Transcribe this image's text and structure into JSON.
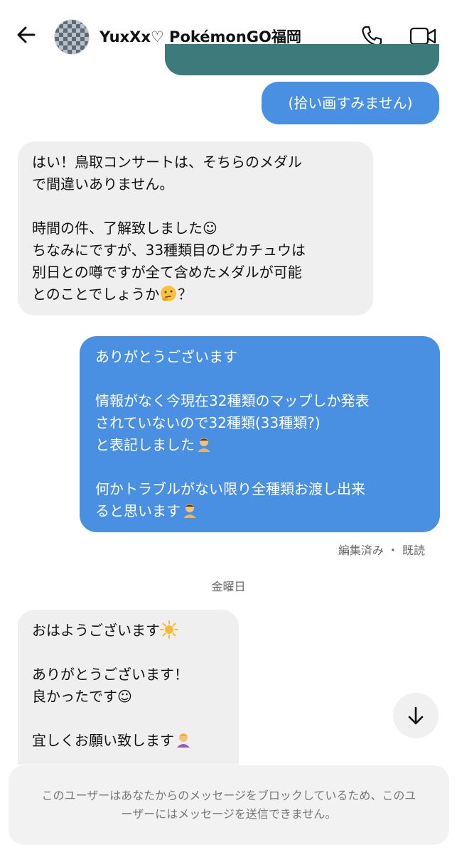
{
  "header": {
    "title": "YuxXx♡ PokémonGO福岡"
  },
  "messages": {
    "pic_caption": "(拾い画すみません)",
    "reply1": "はい！鳥取コンサートは、そちらのメダル\nで間違いありません。\n\n時間の件、了解致しました☺︎\nちなみにですが、33種類目のピカチュウは\n別日との噂ですが全て含めたメダルが可能\nとのことでしょうか",
    "reply1_tail": "？",
    "out2": "ありがとうございます\n\n情報がなく今現在32種類のマップしか発表\nされていないので32種類(33種類?)\nと表記しました",
    "out2_tail": "\n\n何かトラブルがない限り全種類お渡し出来\nると思います",
    "out2_status": "編集済み ・ 既読",
    "day_label": "金曜日",
    "reply3_a": "おはようございます",
    "reply3_b": "\n\nありがとうございます！\n良かったです☺︎\n\n宜しくお願い致します"
  },
  "footer": {
    "blocked_notice": "このユーザーはあなたからのメッセージをブロックしているため、このユーザーにはメッセージを送信できません。"
  },
  "icons": {
    "back": "arrow-left-icon",
    "call": "phone-icon",
    "video": "video-camera-icon",
    "scroll": "arrow-down-icon"
  },
  "colors": {
    "outgoing": "#4a90e2",
    "incoming": "#efefef",
    "teal_image": "#3d7a7c"
  }
}
